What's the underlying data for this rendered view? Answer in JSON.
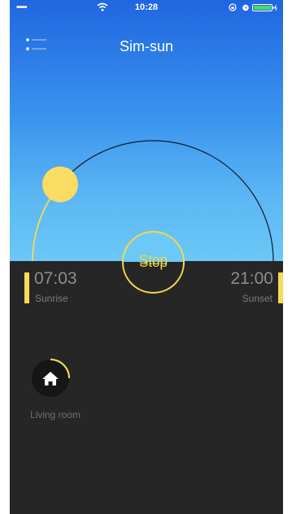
{
  "status_bar": {
    "signal": "•••••",
    "time": "10:28"
  },
  "header": {
    "title": "Sim-sun",
    "menu_icon": "menu-list-icon"
  },
  "sun_arc": {
    "sun_progress": 0.22
  },
  "control": {
    "stop_label": "Stop"
  },
  "sunrise": {
    "time": "07:03",
    "label": "Sunrise"
  },
  "sunset": {
    "time": "21:00",
    "label": "Sunset"
  },
  "rooms": [
    {
      "label": "Living room",
      "icon": "home-icon",
      "progress": 0.25
    }
  ],
  "colors": {
    "accent_yellow": "#f6dc55",
    "sun_yellow": "#fbdc62",
    "sky_top": "#1f66e0",
    "sky_bottom": "#6cc8f7",
    "background": "#262626"
  }
}
